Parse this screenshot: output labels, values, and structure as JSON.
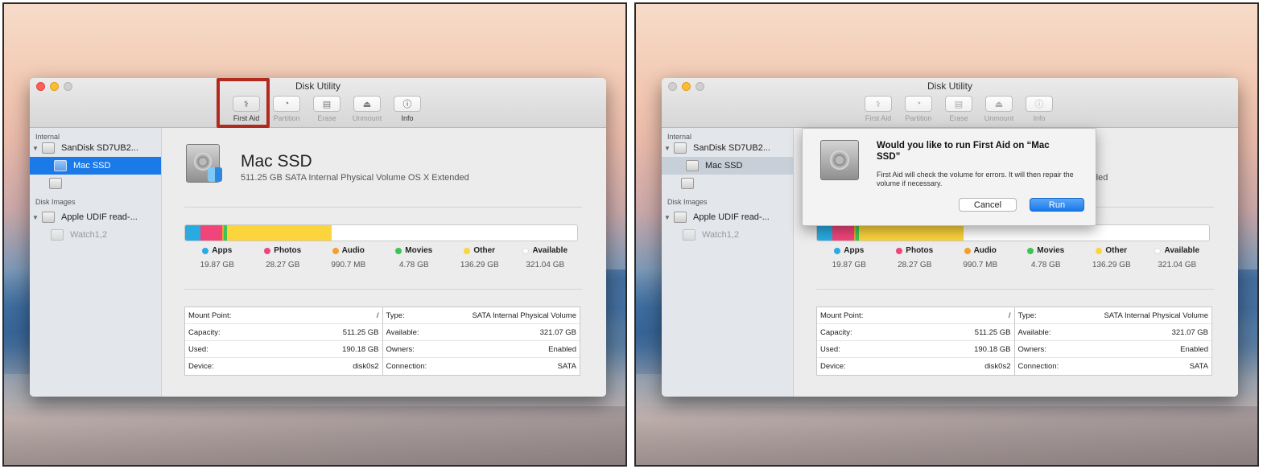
{
  "app": {
    "title": "Disk Utility"
  },
  "toolbar": {
    "first_aid": "First Aid",
    "partition": "Partition",
    "erase": "Erase",
    "unmount": "Unmount",
    "info": "Info"
  },
  "sidebar": {
    "internal_header": "Internal",
    "disk_name": "SanDisk SD7UB2...",
    "volume_name": "Mac SSD",
    "disk_images_header": "Disk Images",
    "image_name": "Apple UDIF read-...",
    "image_volume": "Watch1,2"
  },
  "volume": {
    "name": "Mac SSD",
    "description": "511.25 GB SATA Internal Physical Volume OS X Extended",
    "description_truncated": "ded"
  },
  "usage": {
    "segments": [
      {
        "name": "Apps",
        "value": "19.87 GB",
        "fraction": 0.039,
        "color": "#29abe2"
      },
      {
        "name": "Photos",
        "value": "28.27 GB",
        "fraction": 0.055,
        "color": "#f0457a"
      },
      {
        "name": "Audio",
        "value": "990.7 MB",
        "fraction": 0.004,
        "color": "#f59e2e"
      },
      {
        "name": "Movies",
        "value": "4.78 GB",
        "fraction": 0.009,
        "color": "#3ec453"
      },
      {
        "name": "Other",
        "value": "136.29 GB",
        "fraction": 0.266,
        "color": "#fcd43b"
      },
      {
        "name": "Available",
        "value": "321.04 GB",
        "fraction": 0.627,
        "color": "#ffffff"
      }
    ]
  },
  "info_table": {
    "left": [
      {
        "label": "Mount Point:",
        "value": "/"
      },
      {
        "label": "Capacity:",
        "value": "511.25 GB"
      },
      {
        "label": "Used:",
        "value": "190.18 GB"
      },
      {
        "label": "Device:",
        "value": "disk0s2"
      }
    ],
    "right": [
      {
        "label": "Type:",
        "value": "SATA Internal Physical Volume"
      },
      {
        "label": "Available:",
        "value": "321.07 GB"
      },
      {
        "label": "Owners:",
        "value": "Enabled"
      },
      {
        "label": "Connection:",
        "value": "SATA"
      }
    ]
  },
  "dialog": {
    "title": "Would you like to run First Aid on “Mac SSD”",
    "message": "First Aid will check the volume for errors. It will then repair the volume if necessary.",
    "cancel": "Cancel",
    "run": "Run"
  },
  "colors": {
    "highlight": "#b12a1e",
    "accent": "#1a7ae8"
  }
}
